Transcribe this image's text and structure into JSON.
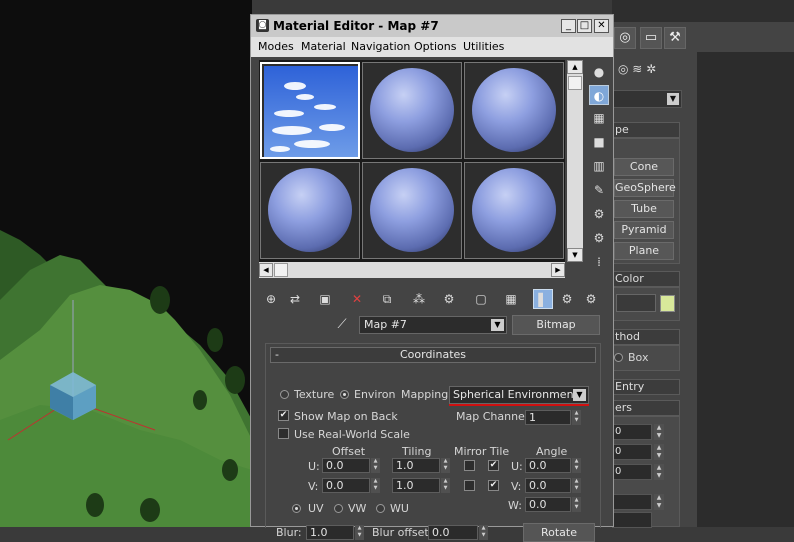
{
  "window": {
    "title": "Material Editor - Map #7",
    "app_icon": "3ds-max-icon",
    "min_label": "_",
    "max_label": "□",
    "close_label": "✕"
  },
  "menu": {
    "items": [
      "Modes",
      "Material",
      "Navigation",
      "Options",
      "Utilities"
    ]
  },
  "slots": [
    {
      "type": "sky-map",
      "selected": true
    },
    {
      "type": "sphere"
    },
    {
      "type": "sphere"
    },
    {
      "type": "sphere"
    },
    {
      "type": "sphere"
    },
    {
      "type": "sphere"
    }
  ],
  "namebar": {
    "map_name": "Map #7",
    "type_button": "Bitmap",
    "eyedropper_icon": "eyedropper-icon"
  },
  "coordinates": {
    "header": "Coordinates",
    "collapse": "-",
    "texture_label": "Texture",
    "environ_label": "Environ",
    "selected_mode": "Environ",
    "mapping_label": "Mapping:",
    "mapping_value": "Spherical Environment",
    "show_map_on_back": "Show Map on Back",
    "show_map_on_back_checked": true,
    "use_real_world": "Use Real-World Scale",
    "use_real_world_checked": false,
    "map_channel_label": "Map Channel:",
    "map_channel_value": "1",
    "offset_label": "Offset",
    "tiling_label": "Tiling",
    "mirror_tile_label": "Mirror Tile",
    "angle_label": "Angle",
    "u_label": "U:",
    "v_label": "V:",
    "w_label": "W:",
    "u_offset": "0.0",
    "v_offset": "0.0",
    "u_tiling": "1.0",
    "v_tiling": "1.0",
    "u_mirror": false,
    "u_tile": true,
    "v_mirror": false,
    "v_tile": true,
    "u_angle": "0.0",
    "v_angle": "0.0",
    "w_angle": "0.0",
    "uv_label": "UV",
    "vw_label": "VW",
    "wu_label": "WU",
    "selected_axis": "UV",
    "blur_label": "Blur:",
    "blur_value": "1.0",
    "blur_offset_label": "Blur offset:",
    "blur_offset_value": "0.0",
    "rotate_button": "Rotate"
  },
  "command_panel": {
    "rollout_type": "pe",
    "buttons": [
      "Cone",
      "GeoSphere",
      "Tube",
      "Pyramid",
      "Plane"
    ],
    "color_header": "Color",
    "method_header": "thod",
    "box_label": "Box",
    "entry_header": "Entry",
    "params_header": "ers",
    "spinner_values": [
      "0",
      "0",
      "0"
    ],
    "swatch_color": "#d8e89a"
  },
  "colors": {
    "viewport_grass": "#4f8a3a",
    "accent_red": "#d01010",
    "sphere_blue": "#8e9fe0"
  }
}
